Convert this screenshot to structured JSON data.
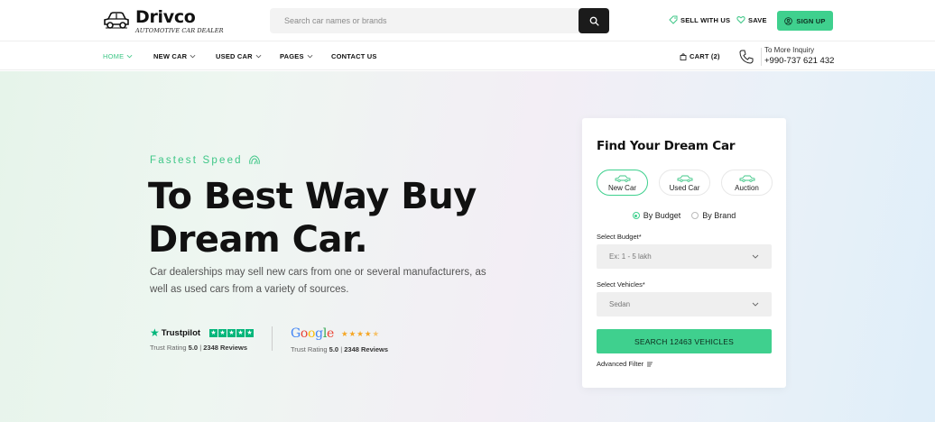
{
  "brand": {
    "name": "Drivco",
    "tagline": "AUTOMOTIVE CAR DEALER"
  },
  "search": {
    "placeholder": "Search car names or brands",
    "value": ""
  },
  "top_actions": {
    "sell": "SELL WITH US",
    "save": "SAVE",
    "signup": "SIGN UP"
  },
  "nav": {
    "items": [
      {
        "label": "HOME",
        "has_dropdown": true,
        "active": true
      },
      {
        "label": "NEW CAR",
        "has_dropdown": true,
        "active": false
      },
      {
        "label": "USED CAR",
        "has_dropdown": true,
        "active": false
      },
      {
        "label": "PAGES",
        "has_dropdown": true,
        "active": false
      },
      {
        "label": "CONTACT US",
        "has_dropdown": false,
        "active": false
      }
    ],
    "cart": "CART (2)",
    "inquiry_label": "To More Inquiry",
    "inquiry_phone": "+990-737 621 432"
  },
  "hero": {
    "kicker": "Fastest Speed",
    "headline_line1": "To Best Way Buy",
    "headline_line2": "Dream Car.",
    "description": "Car dealerships may sell new cars from one or several manufacturers, as well as used cars from a variety of sources."
  },
  "ratings": {
    "trustpilot": {
      "brand": "Trustpilot",
      "stars": 5,
      "label": "Trust Rating",
      "score": "5.0",
      "separator": "|",
      "reviews": "2348 Reviews"
    },
    "google": {
      "brand": "Google",
      "stars": 4.5,
      "label": "Trust Rating",
      "score": "5.0",
      "separator": "|",
      "reviews": "2348 Reviews"
    }
  },
  "finder": {
    "title": "Find Your Dream Car",
    "types": [
      {
        "label": "New Car",
        "active": true
      },
      {
        "label": "Used Car",
        "active": false
      },
      {
        "label": "Auction",
        "active": false
      }
    ],
    "modes": [
      {
        "label": "By Budget",
        "selected": true
      },
      {
        "label": "By Brand",
        "selected": false
      }
    ],
    "budget_label": "Select Budget*",
    "budget_value": "Ex: 1 - 5 lakh",
    "vehicle_label": "Select Vehicles*",
    "vehicle_value": "Sedan",
    "submit": "SEARCH 12463 VEHICLES",
    "advanced": "Advanced Filter"
  },
  "colors": {
    "accent": "#3fd08e",
    "accent_text": "#3fc787",
    "dark": "#1b1b1b",
    "trustpilot": "#00b67a",
    "google_stars": "#f5a623"
  }
}
